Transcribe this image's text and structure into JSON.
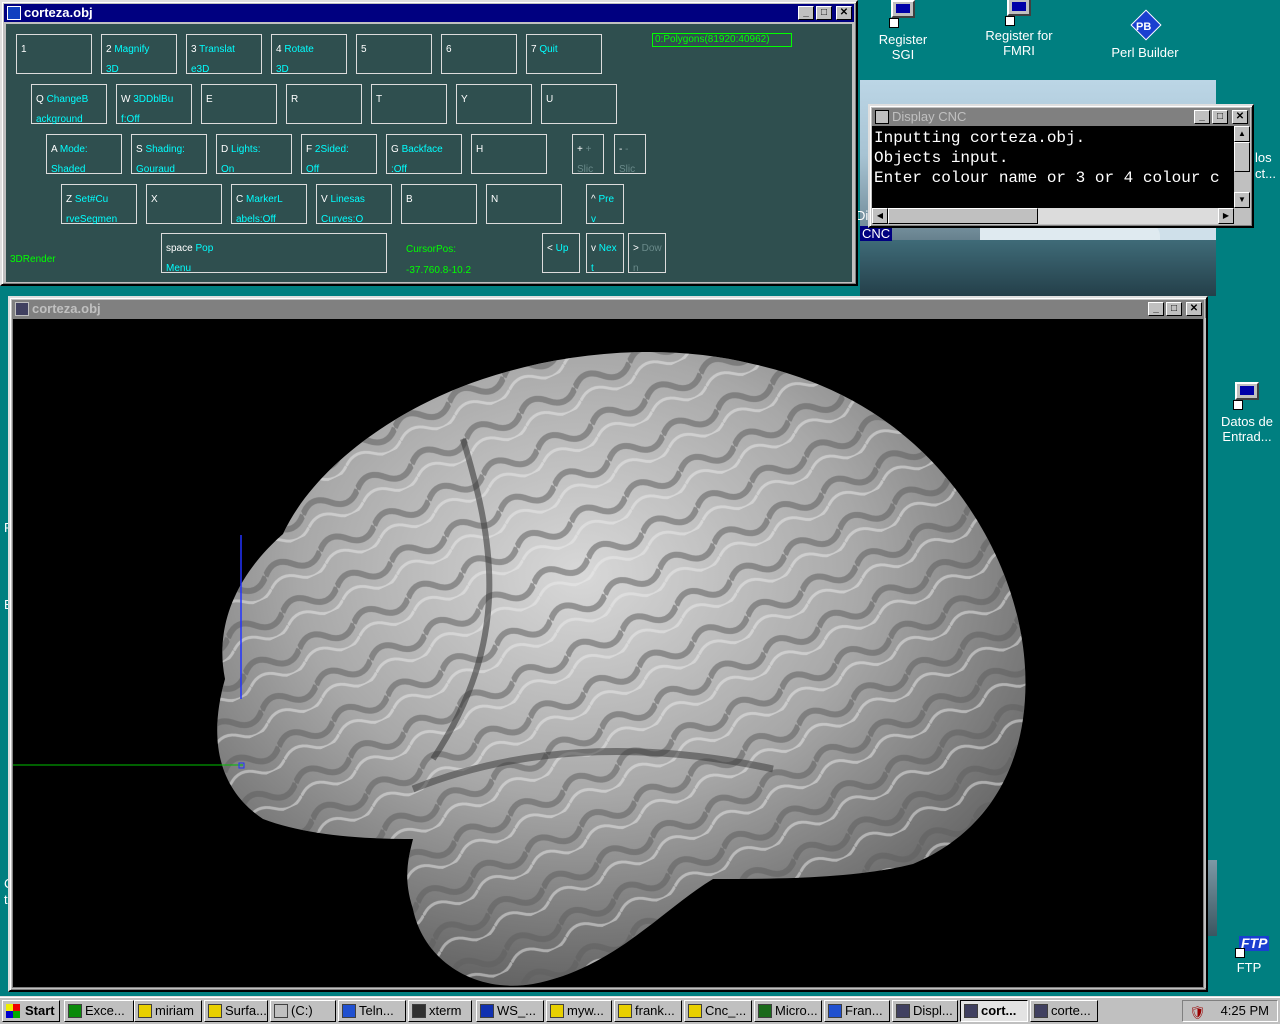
{
  "desktop": {
    "icons": [
      {
        "label": "Register\nSGI",
        "name": "register-sgi"
      },
      {
        "label": "Register for\nFMRI",
        "name": "register-fmri"
      },
      {
        "label": "Perl Builder",
        "name": "perl-builder"
      },
      {
        "label": "Datos de\nEntrad...",
        "name": "datos-de-entrada"
      },
      {
        "label": "FTP",
        "name": "ftp"
      }
    ],
    "partial_labels": {
      "los": "los",
      "ct": "ct...",
      "cnc": "CNC",
      "di": "Di",
      "p": "P",
      "b": "B",
      "c": "C",
      "t": "t"
    }
  },
  "keyboard_window": {
    "title": "corteza.obj",
    "polygons": "0:Polygons(81920:40962)",
    "mode_label": "3DRender",
    "cursor_label": "CursorPos:",
    "cursor_value": "-37.760.8-10.2",
    "keys": [
      {
        "id": "k1",
        "key": "1",
        "l1": "",
        "l2": ""
      },
      {
        "id": "k2",
        "key": "2",
        "l1": "Magnify",
        "l2": "3D"
      },
      {
        "id": "k3",
        "key": "3",
        "l1": "Translat",
        "l2": "e3D"
      },
      {
        "id": "k4",
        "key": "4",
        "l1": "Rotate",
        "l2": "3D"
      },
      {
        "id": "k5",
        "key": "5",
        "l1": "",
        "l2": ""
      },
      {
        "id": "k6",
        "key": "6",
        "l1": "",
        "l2": ""
      },
      {
        "id": "k7",
        "key": "7",
        "l1": "Quit",
        "l2": ""
      },
      {
        "id": "kq",
        "key": "Q",
        "l1": "ChangeB",
        "l2": "ackground"
      },
      {
        "id": "kw",
        "key": "W",
        "l1": "3DDblBu",
        "l2": "f:Off"
      },
      {
        "id": "ke",
        "key": "E",
        "l1": "",
        "l2": ""
      },
      {
        "id": "kr",
        "key": "R",
        "l1": "",
        "l2": ""
      },
      {
        "id": "kt",
        "key": "T",
        "l1": "",
        "l2": ""
      },
      {
        "id": "ky",
        "key": "Y",
        "l1": "",
        "l2": ""
      },
      {
        "id": "ku",
        "key": "U",
        "l1": "",
        "l2": ""
      },
      {
        "id": "ka",
        "key": "A",
        "l1": "Mode:",
        "l2": "Shaded"
      },
      {
        "id": "ks",
        "key": "S",
        "l1": "Shading:",
        "l2": "Gouraud"
      },
      {
        "id": "kd",
        "key": "D",
        "l1": "Lights:",
        "l2": "On"
      },
      {
        "id": "kf",
        "key": "F",
        "l1": "2Sided:",
        "l2": "Off"
      },
      {
        "id": "kg",
        "key": "G",
        "l1": "Backface",
        "l2": ":Off"
      },
      {
        "id": "kh",
        "key": "H",
        "l1": "",
        "l2": ""
      },
      {
        "id": "kplus",
        "key": "+",
        "l1": "+",
        "l2": "Slic",
        "dim": true
      },
      {
        "id": "kminus",
        "key": "-",
        "l1": "-",
        "l2": "Slic",
        "dim": true
      },
      {
        "id": "kz",
        "key": "Z",
        "l1": "Set#Cu",
        "l2": "rveSegmen"
      },
      {
        "id": "kx",
        "key": "X",
        "l1": "",
        "l2": ""
      },
      {
        "id": "kc",
        "key": "C",
        "l1": "MarkerL",
        "l2": "abels:Off"
      },
      {
        "id": "kv",
        "key": "V",
        "l1": "Linesas",
        "l2": "Curves:O"
      },
      {
        "id": "kb",
        "key": "B",
        "l1": "",
        "l2": ""
      },
      {
        "id": "kn",
        "key": "N",
        "l1": "",
        "l2": ""
      },
      {
        "id": "kcaret",
        "key": "^",
        "l1": "Pre",
        "l2": "v"
      },
      {
        "id": "kspace",
        "key": "space",
        "l1": "Pop",
        "l2": "Menu"
      },
      {
        "id": "klt",
        "key": "<",
        "l1": "Up",
        "l2": ""
      },
      {
        "id": "kvv",
        "key": "v",
        "l1": "Nex",
        "l2": "t"
      },
      {
        "id": "kgt",
        "key": ">",
        "l1": "Dow",
        "l2": "n",
        "dim": true
      }
    ]
  },
  "render_window": {
    "title": "corteza.obj"
  },
  "cnc_window": {
    "title": "Display CNC",
    "lines": [
      "Inputting corteza.obj.",
      "Objects input.",
      "Enter colour name or 3 or 4 colour c"
    ]
  },
  "taskbar": {
    "start": "Start",
    "items": [
      {
        "label": "Exce...",
        "name": "excel"
      },
      {
        "label": "miriam",
        "name": "miriam"
      },
      {
        "label": "Surfa...",
        "name": "surfa"
      },
      {
        "label": "(C:)",
        "name": "c-drive"
      },
      {
        "label": "Teln...",
        "name": "telnet"
      },
      {
        "label": "xterm",
        "name": "xterm"
      },
      {
        "label": "WS_...",
        "name": "ws-ftp"
      },
      {
        "label": "myw...",
        "name": "myw"
      },
      {
        "label": "frank...",
        "name": "frank"
      },
      {
        "label": "Cnc_...",
        "name": "cnc"
      },
      {
        "label": "Micro...",
        "name": "micro"
      },
      {
        "label": "Fran...",
        "name": "fran"
      },
      {
        "label": "Displ...",
        "name": "displ"
      },
      {
        "label": "cort...",
        "name": "cort-active"
      },
      {
        "label": "corte...",
        "name": "corte"
      }
    ],
    "clock": "4:25 PM"
  }
}
